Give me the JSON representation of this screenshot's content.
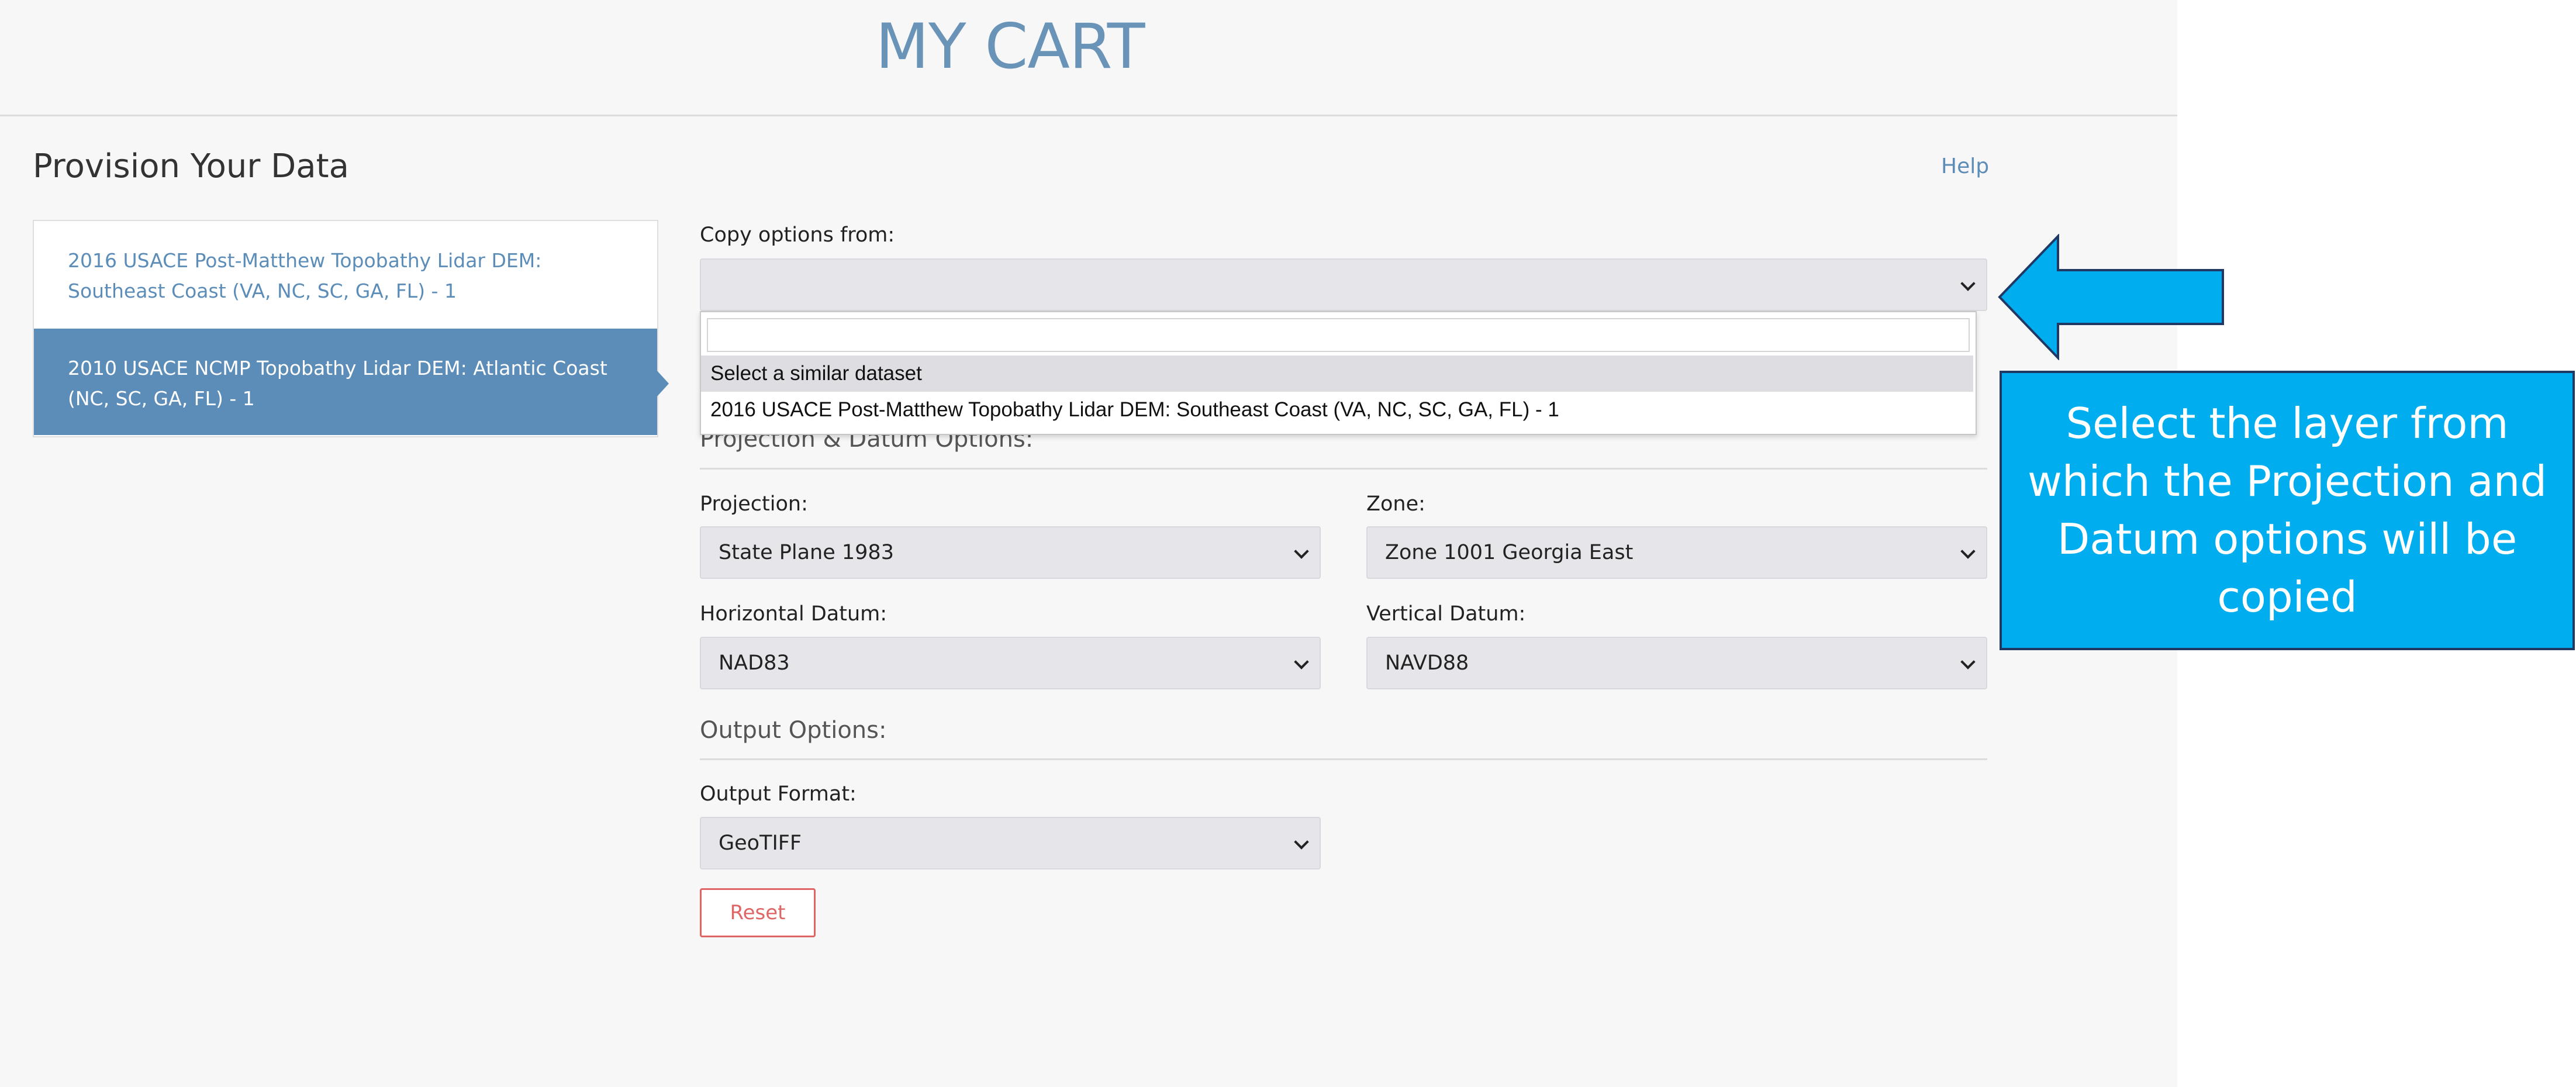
{
  "header": {
    "title": "MY CART"
  },
  "section": {
    "title": "Provision Your Data",
    "help_label": "Help"
  },
  "datasets": [
    {
      "label": "2016 USACE Post-Matthew Topobathy Lidar DEM: Southeast Coast (VA, NC, SC, GA, FL) - 1",
      "active": false
    },
    {
      "label": "2010 USACE NCMP Topobathy Lidar DEM: Atlantic Coast (NC, SC, GA, FL) - 1",
      "active": true
    }
  ],
  "copy_options": {
    "label": "Copy options from:",
    "value": "",
    "search_value": "",
    "options": [
      "Select a similar dataset",
      "2016 USACE Post-Matthew Topobathy Lidar DEM: Southeast Coast (VA, NC, SC, GA, FL) - 1"
    ]
  },
  "projection_datum": {
    "heading": "Projection & Datum Options:",
    "projection": {
      "label": "Projection:",
      "value": "State Plane 1983"
    },
    "zone": {
      "label": "Zone:",
      "value": "Zone 1001 Georgia East"
    },
    "horizontal_datum": {
      "label": "Horizontal Datum:",
      "value": "NAD83"
    },
    "vertical_datum": {
      "label": "Vertical Datum:",
      "value": "NAVD88"
    }
  },
  "output": {
    "heading": "Output Options:",
    "format": {
      "label": "Output Format:",
      "value": "GeoTIFF"
    },
    "reset_label": "Reset"
  },
  "callout": {
    "text": "Select the layer from which the Projection and Datum options will be copied",
    "box_color": "#00aeef",
    "border_color": "#1f3864"
  },
  "colors": {
    "accent": "#5b8db8",
    "danger": "#e06666",
    "background": "#f7f7f7"
  }
}
